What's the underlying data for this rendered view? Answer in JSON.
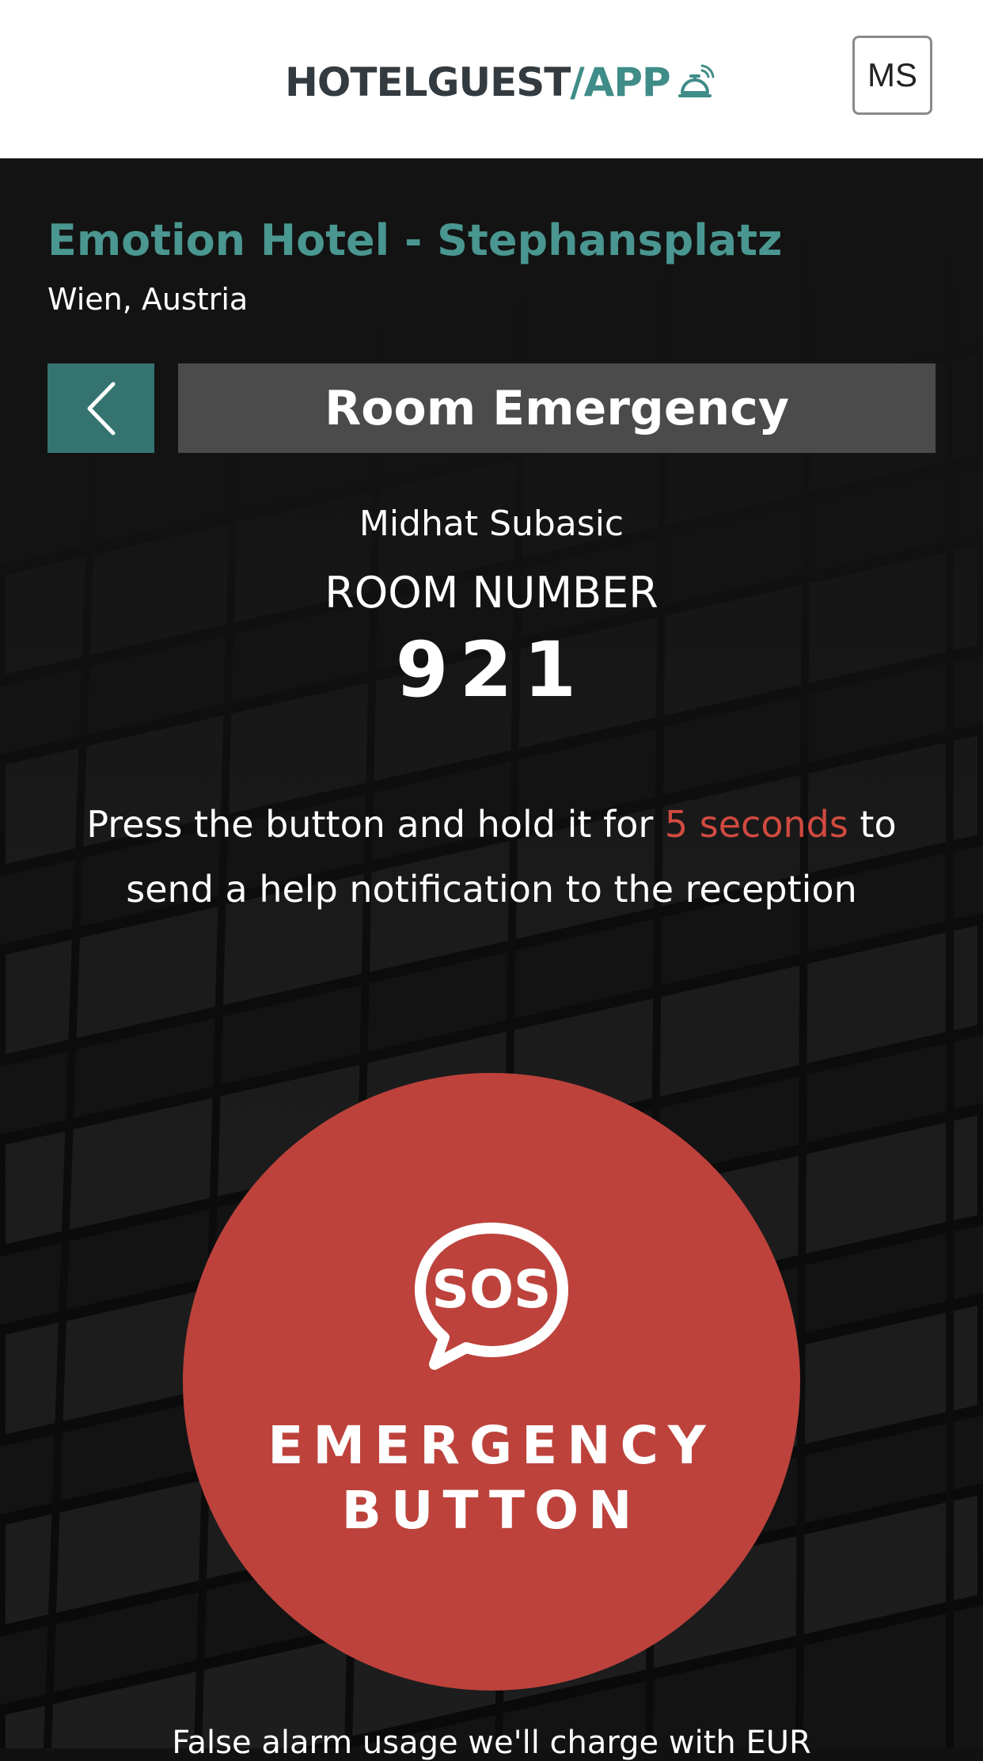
{
  "header": {
    "logo_part1": "HOTELGUEST",
    "logo_part2": "/APP",
    "logo_icon": "reception-bell-icon",
    "user_initials": "MS"
  },
  "hotel": {
    "name": "Emotion Hotel - Stephansplatz",
    "location": "Wien, Austria"
  },
  "nav": {
    "back_icon": "chevron-left-icon",
    "page_title": "Room Emergency"
  },
  "guest": {
    "name": "Midhat Subasic",
    "room_label": "ROOM NUMBER",
    "room_number": "921"
  },
  "instructions": {
    "before": "Press the button and hold it for ",
    "highlight": "5 seconds",
    "after": " to send a help notification to the reception"
  },
  "emergency": {
    "icon": "sos-speech-bubble-icon",
    "label_line1": "EMERGENCY",
    "label_line2": "BUTTON"
  },
  "footer": {
    "false_alarm_text": "False alarm usage we'll charge with EUR"
  },
  "colors": {
    "accent_teal": "#3f8c88",
    "hotel_name": "#4a9690",
    "back_button": "#357370",
    "title_bar": "#4b4b4b",
    "emergency_red": "#bd423c",
    "highlight_red": "#d14a40",
    "background": "#131313"
  }
}
